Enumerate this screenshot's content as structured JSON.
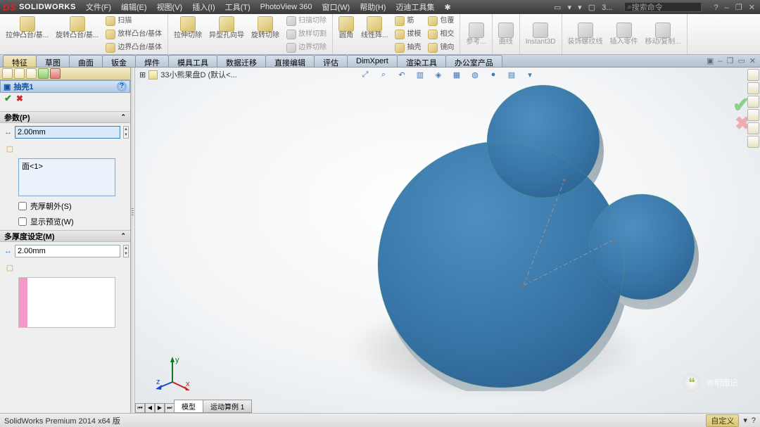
{
  "app": {
    "brand_prefix": "S",
    "brand": "SOLIDWORKS",
    "doc_number": "3..."
  },
  "menus": [
    "文件(F)",
    "编辑(E)",
    "视图(V)",
    "插入(I)",
    "工具(T)",
    "PhotoView 360",
    "窗口(W)",
    "帮助(H)",
    "迈迪工具集",
    "✱"
  ],
  "search_placeholder": "搜索命令",
  "ribbon": {
    "col1": [
      "拉伸凸台/基...",
      "旋转凸台/基..."
    ],
    "col1b": [
      "扫描",
      "放样凸台/基体",
      "边界凸台/基体"
    ],
    "col2": [
      "拉伸切除",
      "异型孔向导",
      "旋转切除"
    ],
    "col2b": [
      "扫描切除",
      "放样切割",
      "边界切除"
    ],
    "col3": [
      "圆角",
      "线性阵..."
    ],
    "col3b": [
      "筋",
      "拔模",
      "抽壳"
    ],
    "col3c": [
      "包覆",
      "相交",
      "镜向"
    ],
    "col4": [
      "参考..."
    ],
    "col5": [
      "曲线"
    ],
    "col6": [
      "Instant3D"
    ],
    "col7": [
      "装饰螺纹线",
      "插入零件",
      "移动/复制..."
    ]
  },
  "feature_tabs": [
    "特征",
    "草图",
    "曲面",
    "钣金",
    "焊件",
    "模具工具",
    "数据迁移",
    "直接编辑",
    "评估",
    "DimXpert",
    "渲染工具",
    "办公室产品"
  ],
  "crumb": "33小熊果盘D  (默认<...",
  "panel": {
    "title": "抽壳1",
    "sec1": "参数(P)",
    "thickness1": "2.00mm",
    "face_list_item": "面<1>",
    "chk_outward": "壳厚朝外(S)",
    "chk_preview": "显示预览(W)",
    "sec2": "多厚度设定(M)",
    "thickness2": "2.00mm"
  },
  "bottom_tabs": {
    "model": "模型",
    "motion": "运动算例 1"
  },
  "status": "SolidWorks Premium 2014 x64 版",
  "status_right": "自定义",
  "watermark": "亦明图记"
}
